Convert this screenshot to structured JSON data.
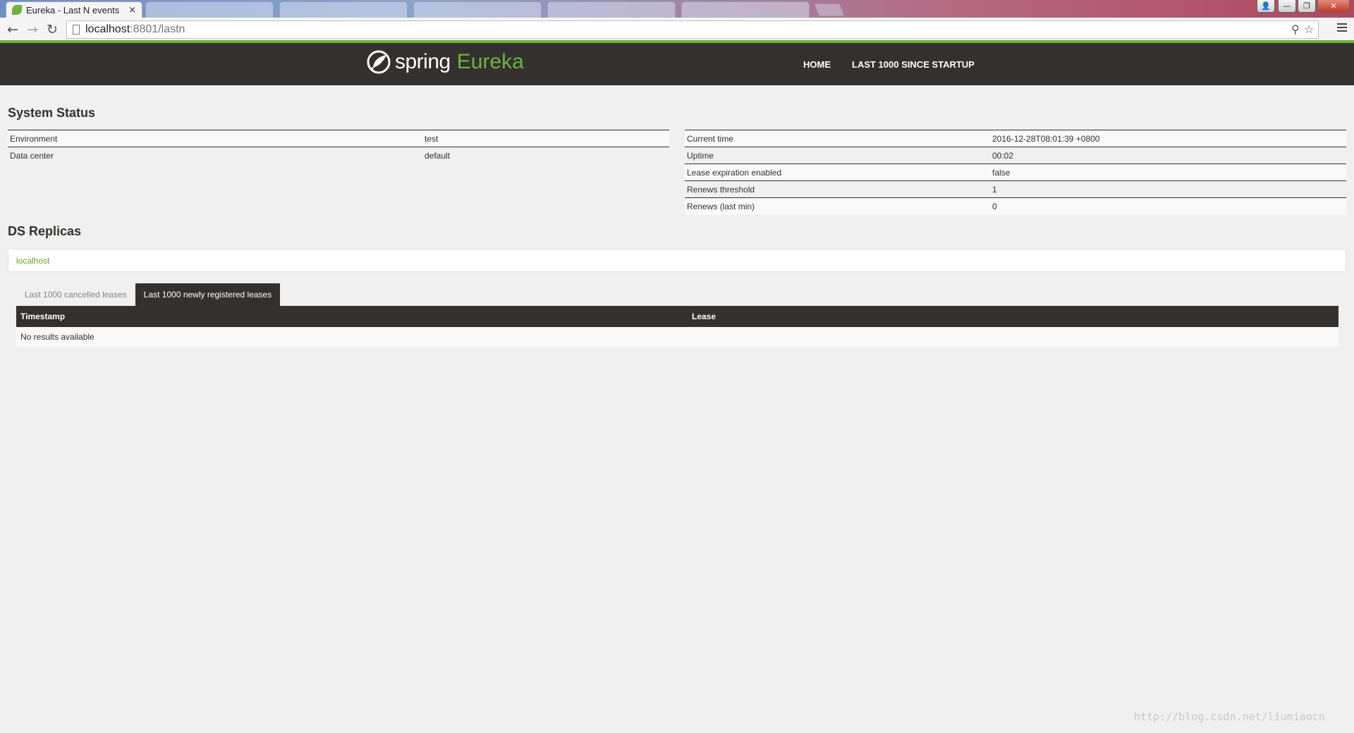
{
  "browser": {
    "tab_title": "Eureka - Last N events",
    "tab_close": "×",
    "url_host": "localhost",
    "url_rest": ":8801/lastn",
    "window_buttons": {
      "account": "👤",
      "minimize": "—",
      "restore": "❐",
      "close": "✕"
    },
    "nav": {
      "back": "←",
      "forward": "→",
      "reload": "↻"
    },
    "omnibox_icons": {
      "search": "⚲",
      "star": "☆"
    }
  },
  "header": {
    "logo_spring": "spring",
    "logo_eureka": "Eureka",
    "nav": [
      "HOME",
      "LAST 1000 SINCE STARTUP"
    ]
  },
  "system_status": {
    "title": "System Status",
    "left": [
      {
        "label": "Environment",
        "value": "test"
      },
      {
        "label": "Data center",
        "value": "default"
      }
    ],
    "right": [
      {
        "label": "Current time",
        "value": "2016-12-28T08:01:39 +0800"
      },
      {
        "label": "Uptime",
        "value": "00:02"
      },
      {
        "label": "Lease expiration enabled",
        "value": "false"
      },
      {
        "label": "Renews threshold",
        "value": "1"
      },
      {
        "label": "Renews (last min)",
        "value": "0"
      }
    ]
  },
  "replicas": {
    "title": "DS Replicas",
    "items": [
      "localhost"
    ]
  },
  "lease_tabs": {
    "tabs": [
      "Last 1000 cancelled leases",
      "Last 1000 newly registered leases"
    ],
    "active_index": 1
  },
  "results_table": {
    "headers": [
      "Timestamp",
      "Lease"
    ],
    "empty_message": "No results available"
  },
  "watermark": "http://blog.csdn.net/liumiaocn",
  "colors": {
    "brand_green": "#6db33f",
    "header_dark": "#34302d",
    "page_bg": "#f0f0f0"
  }
}
